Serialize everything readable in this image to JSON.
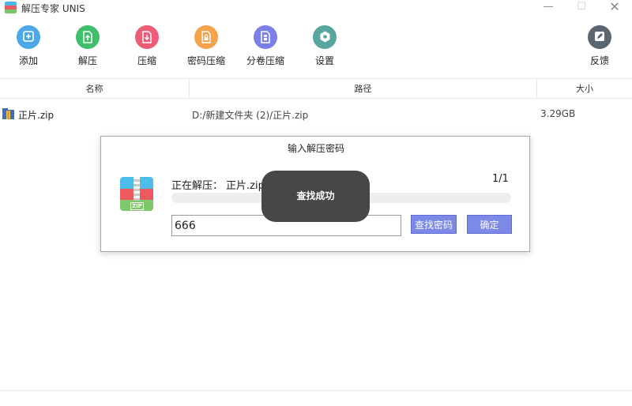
{
  "window": {
    "title": "解压专家 UNIS",
    "min_glyph": "—",
    "max_glyph": "☐",
    "close_glyph": "✕"
  },
  "toolbar": {
    "items": [
      {
        "label": "添加",
        "icon": "plus-icon",
        "color": "#4aa8e8"
      },
      {
        "label": "解压",
        "icon": "extract-icon",
        "color": "#3fbf6b"
      },
      {
        "label": "压缩",
        "icon": "compress-icon",
        "color": "#ee5d78"
      },
      {
        "label": "密码压缩",
        "icon": "lock-icon",
        "color": "#f5a34a"
      },
      {
        "label": "分卷压缩",
        "icon": "split-icon",
        "color": "#7b7fe8"
      },
      {
        "label": "设置",
        "icon": "gear-icon",
        "color": "#57a6a0"
      }
    ],
    "feedback": {
      "label": "反馈",
      "icon": "edit-icon",
      "color": "#5c6670"
    }
  },
  "table": {
    "headers": {
      "name": "名称",
      "path": "路径",
      "size": "大小"
    },
    "rows": [
      {
        "name": "正片.zip",
        "path": "D:/新建文件夹 (2)/正片.zip",
        "size": "3.29GB"
      }
    ]
  },
  "dialog": {
    "title": "输入解压密码",
    "status_prefix": "正在解压：",
    "file_name": "正片.zip",
    "counter": "1/1",
    "password_value": "666",
    "find_button": "查找密码",
    "ok_button": "确定",
    "zip_label": "ZIP"
  },
  "toast": {
    "text": "查找成功"
  }
}
